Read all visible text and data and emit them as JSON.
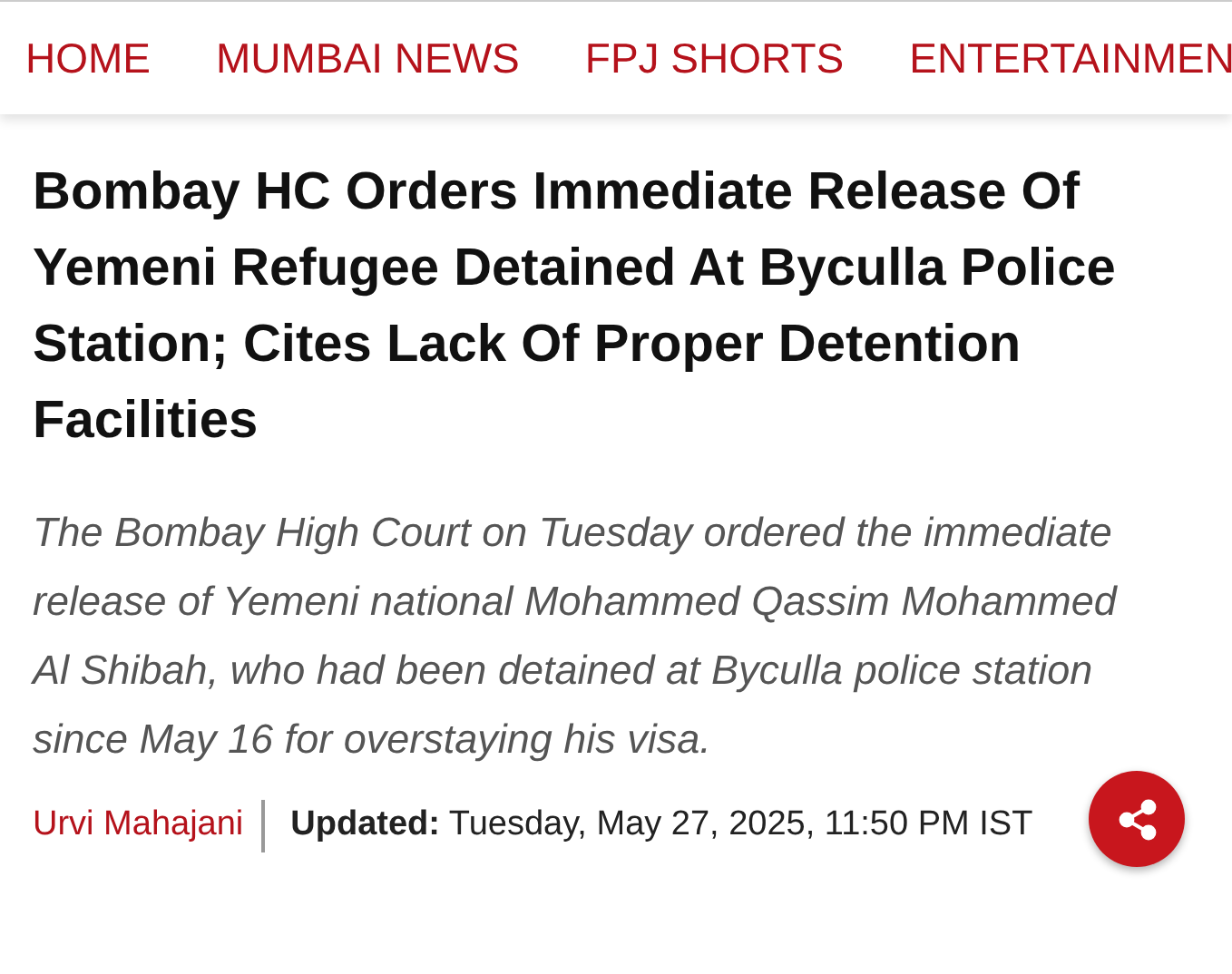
{
  "nav": {
    "items": [
      {
        "label": "HOME"
      },
      {
        "label": "MUMBAI NEWS"
      },
      {
        "label": "FPJ SHORTS"
      },
      {
        "label": "ENTERTAINMEN"
      }
    ]
  },
  "article": {
    "headline": "Bombay HC Orders Immediate Release Of Yemeni Refugee Detained At Byculla Police Station; Cites Lack Of Proper Detention Facilities",
    "summary": "The Bombay High Court on Tuesday ordered the immediate release of Yemeni national Mohammed Qassim Mohammed Al Shibah, who had been detained at Byculla police station since May 16 for overstaying his visa.",
    "author": "Urvi Mahajani",
    "updated": "**Updated:** Tuesday, May 27, 2025, 11:50 PM IST"
  }
}
